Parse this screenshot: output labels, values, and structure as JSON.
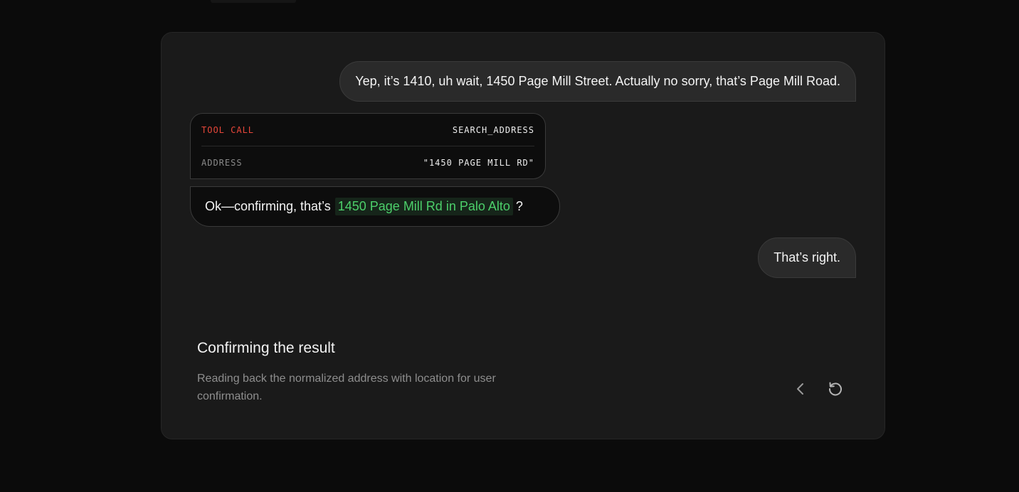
{
  "conversation": {
    "user_message_1": "Yep, it’s 1410, uh wait, 1450 Page Mill Street. Actually no sorry, that’s Page Mill Road.",
    "tool_call": {
      "label": "TOOL CALL",
      "name": "SEARCH_ADDRESS",
      "param_key": "ADDRESS",
      "param_value": "\"1450 PAGE MILL RD\""
    },
    "agent_message": {
      "prefix": "Ok—confirming, that’s",
      "highlight": "1450 Page Mill Rd in Palo Alto",
      "suffix": "?"
    },
    "user_message_2": "That’s right."
  },
  "footer": {
    "title": "Confirming the result",
    "description": "Reading back the normalized address with location for user confirmation."
  },
  "controls": {
    "prev_icon": "chevron-left-icon",
    "restart_icon": "restart-icon"
  },
  "colors": {
    "tool_label": "#e8473a",
    "highlight": "#4ccf6a"
  }
}
